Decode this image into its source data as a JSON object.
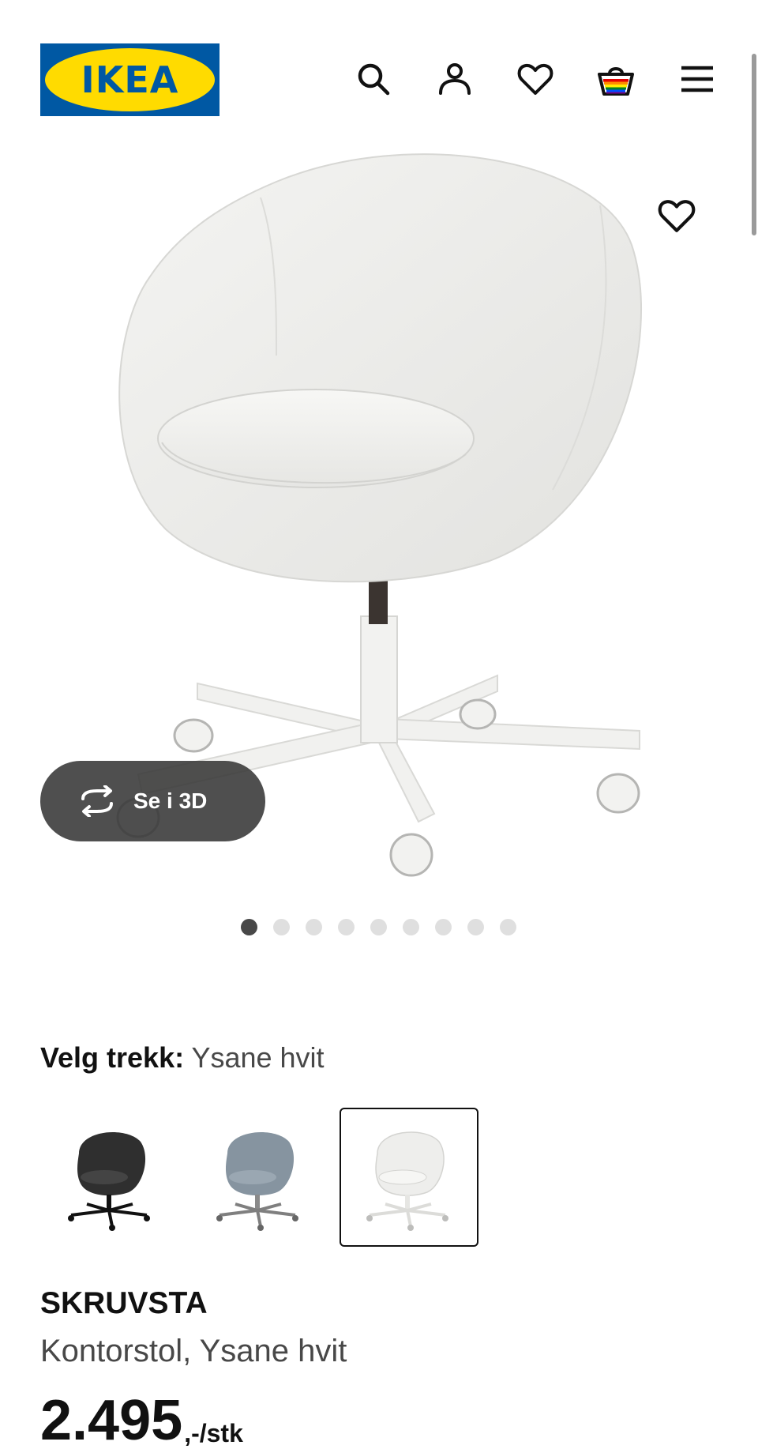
{
  "header": {
    "logo_text": "IKEA",
    "icons": [
      "search-icon",
      "user-icon",
      "heart-icon",
      "basket-icon",
      "menu-icon"
    ]
  },
  "gallery": {
    "view_3d_label": "Se i 3D",
    "image_count": 9,
    "active_index": 0
  },
  "variant": {
    "label": "Velg trekk:",
    "value": "Ysane hvit",
    "options": [
      "black",
      "blue-grey",
      "white"
    ],
    "selected_index": 2
  },
  "product": {
    "name": "SKRUVSTA",
    "description": "Kontorstol, Ysane hvit",
    "price_integer": "2.495",
    "price_suffix": ",-/stk"
  },
  "colors": {
    "ikea_blue": "#0058a3",
    "ikea_yellow": "#ffdb00"
  }
}
